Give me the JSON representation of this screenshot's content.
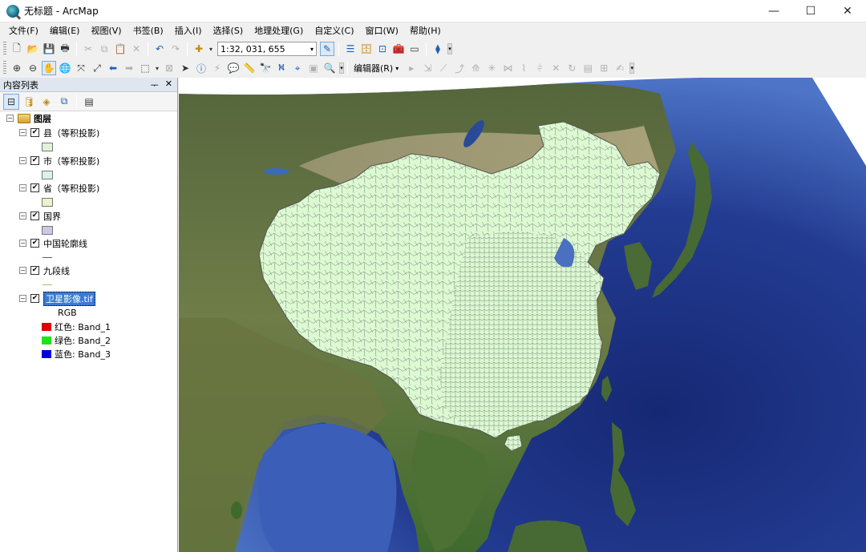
{
  "window": {
    "title": "无标题 - ArcMap",
    "minimize": "—",
    "maximize": "☐",
    "close": "✕"
  },
  "menu": [
    "文件(F)",
    "编辑(E)",
    "视图(V)",
    "书签(B)",
    "插入(I)",
    "选择(S)",
    "地理处理(G)",
    "自定义(C)",
    "窗口(W)",
    "帮助(H)"
  ],
  "toolbar": {
    "scale_value": "1:32, 031, 655",
    "editor_label": "编辑器(R)"
  },
  "toc": {
    "title": "内容列表",
    "pin": "📌",
    "close": "✕",
    "root_label": "图层",
    "layers": [
      {
        "name": "县（等积投影)",
        "checked": true,
        "symbol": "fill",
        "color": "#dff3d8"
      },
      {
        "name": "市（等积投影)",
        "checked": true,
        "symbol": "fill",
        "color": "#d8f3ee"
      },
      {
        "name": "省（等积投影)",
        "checked": true,
        "symbol": "fill",
        "color": "#ecf2c9"
      },
      {
        "name": "国界",
        "checked": true,
        "symbol": "fill",
        "color": "#c9c9e8"
      },
      {
        "name": "中国轮廓线",
        "checked": true,
        "symbol": "line",
        "color": "#4a5aa8"
      },
      {
        "name": "九段线",
        "checked": true,
        "symbol": "line",
        "color": "#a0c070"
      },
      {
        "name": "卫星影像.tif",
        "checked": true,
        "symbol": "raster",
        "selected": true
      }
    ],
    "raster_legend": {
      "rgb_label": "RGB",
      "bands": [
        {
          "label": "红色:    Band_1",
          "color": "#e00000"
        },
        {
          "label": "绿色:  Band_2",
          "color": "#20e020"
        },
        {
          "label": "蓝色:    Band_3",
          "color": "#0000e0"
        }
      ]
    }
  },
  "colors": {
    "ocean_deep": "#1b2f7a",
    "ocean_shallow": "#4f78c8",
    "land_green": "#5f7a3e",
    "desert": "#b9aa86",
    "china_fill": "#dcfad2",
    "boundary": "#6a6a6a"
  }
}
